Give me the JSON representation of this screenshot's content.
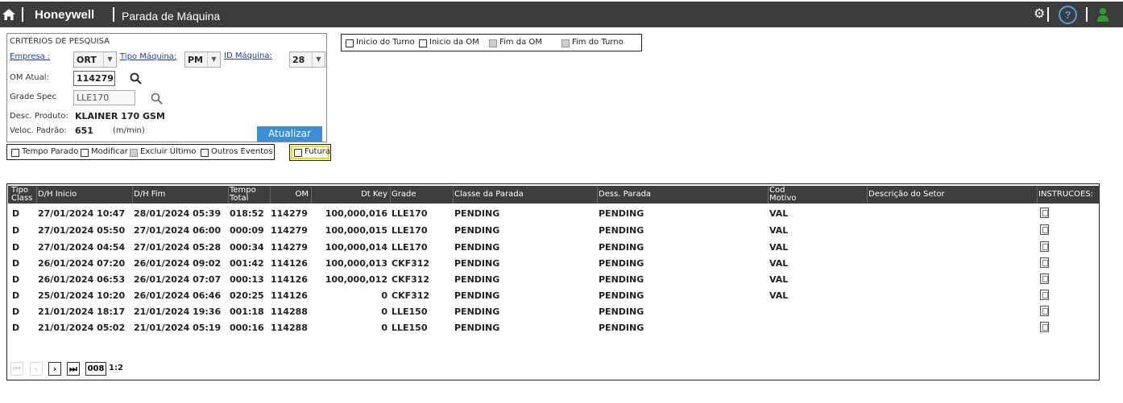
{
  "header": {
    "brand": "Honeywell",
    "title": "Parada de Máquina",
    "icons": [
      "home-icon",
      "gear-icon",
      "help-icon",
      "user-icon"
    ],
    "help_glyph": "?"
  },
  "criteria": {
    "title": "CRITÉRIOS DE PESQUISA",
    "empresa_label": "Empresa :",
    "empresa_value": "ORT",
    "tipo_label": "Tipo Máquina:",
    "tipo_value": "PM",
    "id_label": "ID Máquina:",
    "id_value": "28",
    "om_label": "OM Atual:",
    "om_value": "114279",
    "grade_label": "Grade Spec",
    "grade_value": "LLE170",
    "desc_label": "Desc. Produto:",
    "desc_value": "KLAINER 170 GSM",
    "veloc_label": "Veloc. Padrão:",
    "veloc_value": "651",
    "veloc_unit": "(m/min)",
    "update_button": "Atualizar"
  },
  "period_options": [
    "Inicio do Turno",
    "Inicio da OM",
    "Fim da OM",
    "Fim do Turno"
  ],
  "event_options": [
    "Tempo Parado",
    "Modificar",
    "Excluir Último",
    "Outros Eventos"
  ],
  "future_option": "Futura",
  "table": {
    "headers": {
      "tipo": "Tipo\nClass",
      "ini": "D/H Inicio",
      "fim": "D/H Fim",
      "tempo": "Tempo\nTotal",
      "om": "OM",
      "dtkey": "Dt Key",
      "grade": "Grade",
      "classe": "Classe da Parada",
      "dess": "Dess. Parada",
      "cod": "Cod\nMotivo",
      "setor": "Descrição do Setor",
      "instr": "INSTRUCOES:"
    },
    "rows": [
      {
        "tipo": "D",
        "ini": "27/01/2024 10:47",
        "fim": "28/01/2024 05:39",
        "tempo": "018:52",
        "om": "114279",
        "dtkey": "100,000,016",
        "grade": "LLE170",
        "classe": "PENDING",
        "dess": "PENDING",
        "cod": "VAL"
      },
      {
        "tipo": "D",
        "ini": "27/01/2024 05:50",
        "fim": "27/01/2024 06:00",
        "tempo": "000:09",
        "om": "114279",
        "dtkey": "100,000,015",
        "grade": "LLE170",
        "classe": "PENDING",
        "dess": "PENDING",
        "cod": "VAL"
      },
      {
        "tipo": "D",
        "ini": "27/01/2024 04:54",
        "fim": "27/01/2024 05:28",
        "tempo": "000:34",
        "om": "114279",
        "dtkey": "100,000,014",
        "grade": "LLE170",
        "classe": "PENDING",
        "dess": "PENDING",
        "cod": "VAL"
      },
      {
        "tipo": "D",
        "ini": "26/01/2024 07:20",
        "fim": "26/01/2024 09:02",
        "tempo": "001:42",
        "om": "114126",
        "dtkey": "100,000,013",
        "grade": "CKF312",
        "classe": "PENDING",
        "dess": "PENDING",
        "cod": "VAL"
      },
      {
        "tipo": "D",
        "ini": "26/01/2024 06:53",
        "fim": "26/01/2024 07:07",
        "tempo": "000:13",
        "om": "114126",
        "dtkey": "100,000,012",
        "grade": "CKF312",
        "classe": "PENDING",
        "dess": "PENDING",
        "cod": "VAL"
      },
      {
        "tipo": "D",
        "ini": "25/01/2024 10:20",
        "fim": "26/01/2024 06:46",
        "tempo": "020:25",
        "om": "114126",
        "dtkey": "0",
        "grade": "CKF312",
        "classe": "PENDING",
        "dess": "PENDING",
        "cod": "VAL"
      },
      {
        "tipo": "D",
        "ini": "21/01/2024 18:17",
        "fim": "21/01/2024 19:36",
        "tempo": "001:18",
        "om": "114288",
        "dtkey": "0",
        "grade": "LLE150",
        "classe": "PENDING",
        "dess": "PENDING",
        "cod": ""
      },
      {
        "tipo": "D",
        "ini": "21/01/2024 05:02",
        "fim": "21/01/2024 05:19",
        "tempo": "000:16",
        "om": "114288",
        "dtkey": "0",
        "grade": "LLE150",
        "classe": "PENDING",
        "dess": "PENDING",
        "cod": ""
      }
    ]
  },
  "pager": {
    "page_size": "008",
    "page_info": "1:2",
    "first": "⏮",
    "prev": "‹",
    "next": "›",
    "last": "⏭"
  },
  "colors": {
    "topbar": "#3c3c3c",
    "accent": "#3a8fd6",
    "link": "#1a3ec9",
    "user_icon": "#2e9e2e",
    "future_highlight": "#e8e000"
  }
}
